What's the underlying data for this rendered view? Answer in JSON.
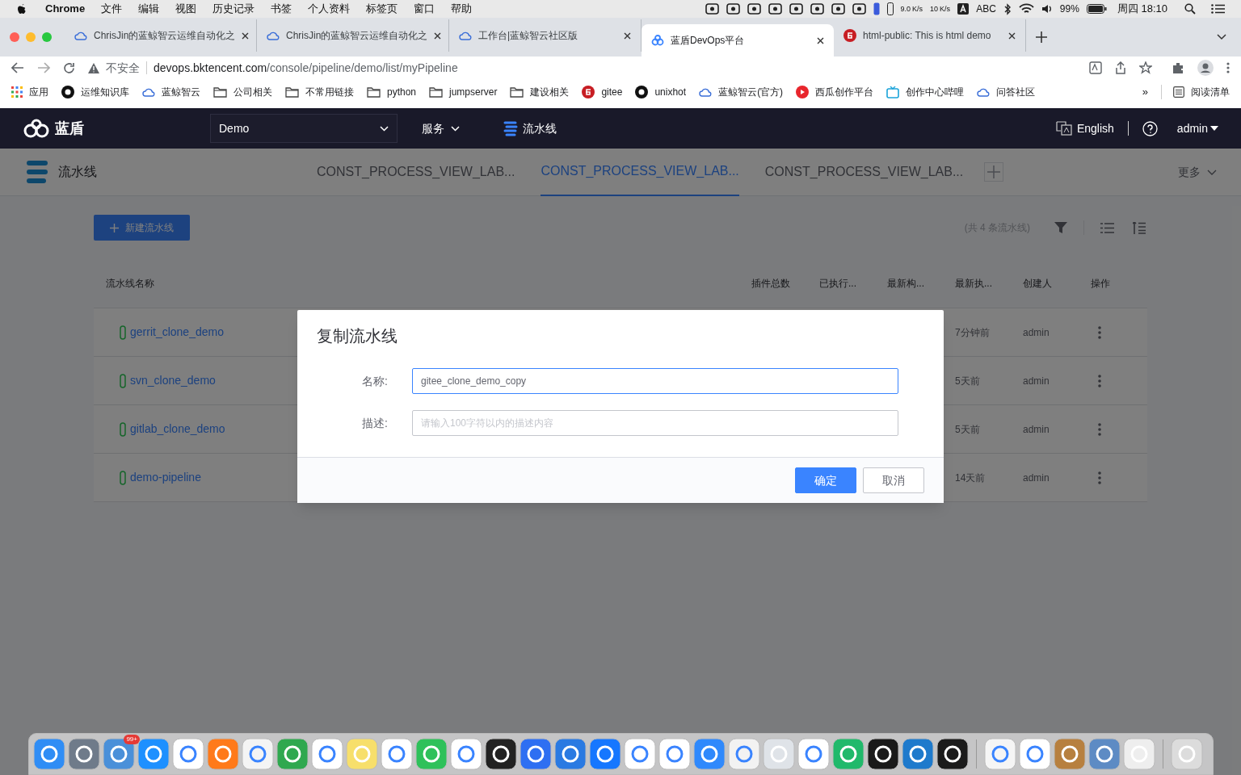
{
  "menubar": {
    "app": "Chrome",
    "menus": [
      "文件",
      "编辑",
      "视图",
      "历史记录",
      "书签",
      "个人资料",
      "标签页",
      "窗口",
      "帮助"
    ],
    "net_speed": [
      {
        "value": "9.0",
        "unit": "K/s"
      },
      {
        "value": "10",
        "unit": "K/s"
      }
    ],
    "input_source": "ABC",
    "battery": "99%",
    "clock": "周四 18:10"
  },
  "browser": {
    "tabs": [
      {
        "title": "ChrisJin的蓝鲸智云运维自动化之",
        "kind": "cloud",
        "selected": false
      },
      {
        "title": "ChrisJin的蓝鲸智云运维自动化之",
        "kind": "cloud",
        "selected": false
      },
      {
        "title": "工作台|蓝鲸智云社区版",
        "kind": "cloud",
        "selected": false
      },
      {
        "title": "蓝盾DevOps平台",
        "kind": "devops",
        "selected": true
      },
      {
        "title": "html-public: This is html demo",
        "kind": "gitee",
        "selected": false
      }
    ],
    "security": "不安全",
    "url_host": "devops.bktencent.com",
    "url_path": "/console/pipeline/demo/list/myPipeline",
    "bookmarks": [
      {
        "label": "应用",
        "kind": "apps"
      },
      {
        "label": "运维知识库",
        "kind": "github"
      },
      {
        "label": "蓝鲸智云",
        "kind": "cloud"
      },
      {
        "label": "公司相关",
        "kind": "folder"
      },
      {
        "label": "不常用链接",
        "kind": "folder"
      },
      {
        "label": "python",
        "kind": "folder"
      },
      {
        "label": "jumpserver",
        "kind": "folder"
      },
      {
        "label": "建设相关",
        "kind": "folder"
      },
      {
        "label": "gitee",
        "kind": "gitee"
      },
      {
        "label": "unixhot",
        "kind": "github"
      },
      {
        "label": "蓝鲸智云(官方)",
        "kind": "cloud"
      },
      {
        "label": "西瓜创作平台",
        "kind": "video"
      },
      {
        "label": "创作中心哔哩",
        "kind": "tv"
      },
      {
        "label": "问答社区",
        "kind": "cloud"
      }
    ],
    "more_bookmarks": "»",
    "reading_list": "阅读清单"
  },
  "app_header": {
    "logo": "蓝盾",
    "project": "Demo",
    "nav": [
      "服务",
      "流水线"
    ],
    "language": "English",
    "user": "admin"
  },
  "sub_header": {
    "title": "流水线",
    "tabs": [
      {
        "label": "CONST_PROCESS_VIEW_LAB...",
        "selected": false
      },
      {
        "label": "CONST_PROCESS_VIEW_LAB...",
        "selected": true
      },
      {
        "label": "CONST_PROCESS_VIEW_LAB...",
        "selected": false
      }
    ],
    "more": "更多"
  },
  "toolbar": {
    "new_button": "新建流水线",
    "count": "(共 4 条流水线)"
  },
  "table": {
    "columns": [
      "流水线名称",
      "插件总数",
      "已执行...",
      "最新构...",
      "最新执...",
      "创建人",
      "操作"
    ],
    "rows": [
      {
        "name": "gerrit_clone_demo",
        "last_run": "7分钟前",
        "creator": "admin"
      },
      {
        "name": "svn_clone_demo",
        "last_run": "5天前",
        "creator": "admin"
      },
      {
        "name": "gitlab_clone_demo",
        "last_run": "5天前",
        "creator": "admin"
      },
      {
        "name": "demo-pipeline",
        "last_run": "14天前",
        "creator": "admin"
      }
    ]
  },
  "dialog": {
    "title": "复制流水线",
    "fields": [
      {
        "label": "名称:",
        "value": "gitee_clone_demo_copy",
        "focused": true
      },
      {
        "label": "描述:",
        "placeholder": "请输入100字符以内的描述内容",
        "focused": false
      }
    ],
    "buttons": [
      {
        "label": "确定",
        "kind": "primary"
      },
      {
        "label": "取消",
        "kind": "secondary"
      }
    ]
  },
  "dock": {
    "badge": "99+"
  }
}
